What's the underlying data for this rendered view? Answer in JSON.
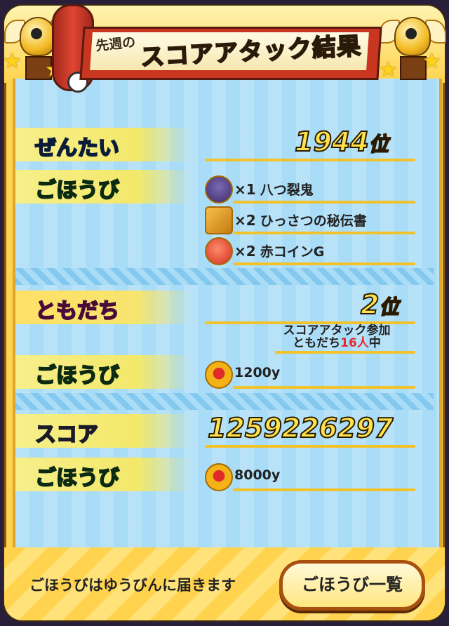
{
  "header": {
    "title_prefix": "先週の",
    "title_main": "スコアアタック結果"
  },
  "overall": {
    "label": "ぜんたい",
    "rank": "1944",
    "rank_unit": "位"
  },
  "overall_rewards": {
    "label": "ごほうび",
    "items": [
      {
        "qty": "×1",
        "name": "八つ裂鬼",
        "icon": "oni-medal-icon"
      },
      {
        "qty": "×2",
        "name": "ひっさつの秘伝書",
        "icon": "scroll-book-icon"
      },
      {
        "qty": "×2",
        "name": "赤コインG",
        "icon": "red-coin-icon"
      }
    ]
  },
  "friends": {
    "label": "ともだち",
    "rank": "2",
    "rank_unit": "位",
    "note_line1": "スコアアタック参加",
    "note_prefix": "ともだち",
    "note_count": "16人",
    "note_suffix": "中"
  },
  "friends_rewards": {
    "label": "ごほうび",
    "amount": "1200y",
    "icon": "money-bag-icon"
  },
  "score": {
    "label": "スコア",
    "value": "1259226297"
  },
  "score_rewards": {
    "label": "ごほうび",
    "amount": "8000y",
    "icon": "money-bag-icon"
  },
  "footer": {
    "notice": "ごほうびはゆうびんに届きます",
    "list_button": "ごほうび一覧"
  },
  "colors": {
    "panel_bg": "#a9dcf6",
    "frame": "#ffd34d",
    "banner_red": "#c8361f",
    "rank_gold": "#ffe14a",
    "highlight_red": "#e02b2b"
  }
}
